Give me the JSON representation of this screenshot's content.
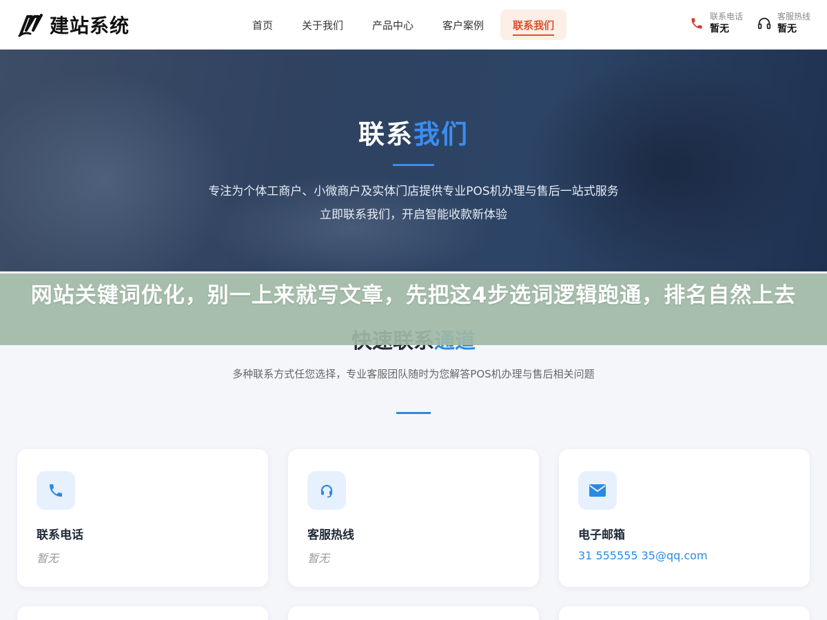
{
  "brand": {
    "name": "建站系统",
    "logo_icon": "brand-logo-icon"
  },
  "nav": {
    "items": [
      {
        "label": "首页",
        "active": false
      },
      {
        "label": "关于我们",
        "active": false
      },
      {
        "label": "产品中心",
        "active": false
      },
      {
        "label": "客户案例",
        "active": false
      },
      {
        "label": "联系我们",
        "active": true
      }
    ],
    "active_color": "#d9522a"
  },
  "header_contacts": {
    "phone": {
      "label": "联系电话",
      "value": "暂无",
      "icon": "phone-icon"
    },
    "service": {
      "label": "客服热线",
      "value": "暂无",
      "icon": "headset-icon"
    }
  },
  "hero": {
    "title_main": "联系",
    "title_accent": "我们",
    "subtitle_line1": "专注为个体工商户、小微商户及实体门店提供专业POS机办理与售后一站式服务",
    "subtitle_line2": "立即联系我们，开启智能收款新体验",
    "accent_color": "#3b8df0"
  },
  "banner": {
    "text": "网站关键词优化，别一上来就写文章，先把这4步选词逻辑跑通，排名自然上去"
  },
  "section": {
    "title_main": "快速联系",
    "title_accent": "通道",
    "description": "多种联系方式任您选择，专业客服团队随时为您解答POS机办理与售后相关问题",
    "accent_color": "#2a8ae0"
  },
  "cards": [
    {
      "title": "联系电话",
      "value": "暂无",
      "icon": "phone-icon"
    },
    {
      "title": "客服热线",
      "value": "暂无",
      "icon": "headset-icon"
    },
    {
      "title": "电子邮箱",
      "value": "31 555555 35@qq.com",
      "icon": "mail-icon"
    }
  ]
}
